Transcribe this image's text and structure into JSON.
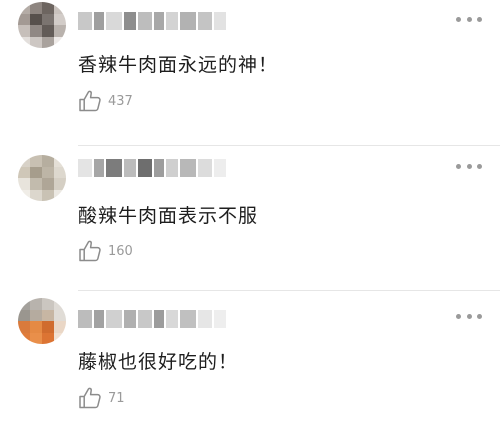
{
  "comments": [
    {
      "text": "香辣牛肉面永远的神！",
      "likes": "437",
      "avatar_colors": [
        "#b4aca6",
        "#8e8580",
        "#6d6560",
        "#c9c2bd",
        "#a39a94",
        "#57504c",
        "#7b7470",
        "#d2ccc8",
        "#c6bfba",
        "#908884",
        "#625b57",
        "#b9b2ad",
        "#e3dfdc",
        "#cdc7c3",
        "#a9a29d",
        "#eeeae8"
      ],
      "username_blocks": [
        "#c8c8c8",
        "#9f9f9f",
        "#d9d9d9",
        "#8e8e8e",
        "#bdbdbd",
        "#a8a8a8",
        "#d3d3d3",
        "#b2b2b2",
        "#c4c4c4",
        "#e2e2e2"
      ]
    },
    {
      "text": "酸辣牛肉面表示不服",
      "likes": "160",
      "avatar_colors": [
        "#d8d2c8",
        "#c8c0b2",
        "#b6ae9f",
        "#e4dfd6",
        "#cfc7b8",
        "#a69d8c",
        "#bdb5a6",
        "#ddd8ce",
        "#e8e4dc",
        "#c2bbad",
        "#afa697",
        "#d5cfc4",
        "#f0ede7",
        "#dcd7cd",
        "#c9c2b4",
        "#ebe8e2"
      ],
      "username_blocks": [
        "#e4e4e4",
        "#a6a6a6",
        "#7c7c7c",
        "#bcbcbc",
        "#6e6e6e",
        "#9d9d9d",
        "#cfcfcf",
        "#b8b8b8",
        "#dcdcdc",
        "#ededed"
      ]
    },
    {
      "text": "藤椒也很好吃的！",
      "likes": "71",
      "avatar_colors": [
        "#a4a19c",
        "#b8b3ad",
        "#cbc6c0",
        "#dedad5",
        "#9a968f",
        "#b5ab9f",
        "#c7b6a3",
        "#e0dcd6",
        "#d97a3c",
        "#e58a44",
        "#d06c2e",
        "#ead7c6",
        "#e07c3a",
        "#e98f4a",
        "#dc7433",
        "#f1e1d2"
      ],
      "username_blocks": [
        "#bcbcbc",
        "#a2a2a2",
        "#d0d0d0",
        "#b0b0b0",
        "#c8c8c8",
        "#9c9c9c",
        "#d8d8d8",
        "#c0c0c0",
        "#e6e6e6",
        "#eeeeee"
      ]
    }
  ]
}
